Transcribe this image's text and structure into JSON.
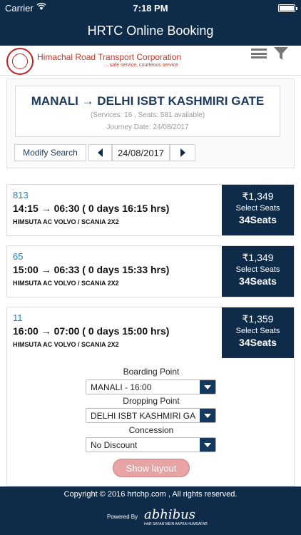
{
  "status_bar": {
    "carrier": "Carrier",
    "time": "7:18 PM"
  },
  "nav": {
    "title": "HRTC Online Booking"
  },
  "brand": {
    "name": "Himachal Road Transport Corporation",
    "tagline": "... safe service, courteous service"
  },
  "search": {
    "route": "MANALI → DELHI ISBT KASHMIRI GATE",
    "summary": "(Services: 16 , Seats: 581 available)",
    "journey_date": "Journey Date: 24/08/2017",
    "modify_label": "Modify Search",
    "date": "24/08/2017"
  },
  "buses": [
    {
      "number": "813",
      "time": "14:15 → 06:30 ( 0 days 16:15 hrs)",
      "type": "HIMSUTA AC VOLVO / SCANIA 2X2",
      "fare": "₹1,349",
      "select": "Select Seats",
      "seats": "34Seats"
    },
    {
      "number": "65",
      "time": "15:00 → 06:33 ( 0 days 15:33 hrs)",
      "type": "HIMSUTA AC VOLVO / SCANIA 2X2",
      "fare": "₹1,349",
      "select": "Select Seats",
      "seats": "34Seats"
    },
    {
      "number": "11",
      "time": "16:00 → 07:00 ( 0 days 15:00 hrs)",
      "type": "HIMSUTA AC VOLVO / SCANIA 2X2",
      "fare": "₹1,359",
      "select": "Select Seats",
      "seats": "34Seats"
    }
  ],
  "booking": {
    "boarding_label": "Boarding Point",
    "boarding_value": "MANALI - 16:00",
    "dropping_label": "Dropping Point",
    "dropping_value": "DELHI ISBT KASHMIRI GA",
    "concession_label": "Concession",
    "concession_value": "No Discount",
    "show_layout_label": "Show layout"
  },
  "footer": {
    "copyright": "Copyright © 2016 hrtchp.com , All rights reserved.",
    "powered_by": "Powered By",
    "partner": "abhibus",
    "partner_tagline": "HAR SAFAR MEIN AAPKA HUMSAFAR"
  },
  "colors": {
    "primary": "#0f2b4a",
    "link": "#1a7fc2",
    "brand_red": "#c0392b",
    "button_pink": "#e8a4a4"
  }
}
